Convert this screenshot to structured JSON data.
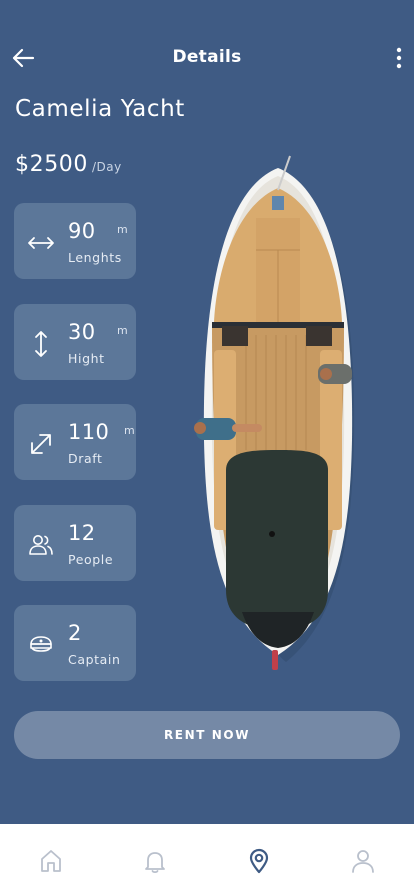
{
  "header": {
    "title": "Details",
    "back_icon": "arrow-left-icon",
    "more_icon": "more-vertical-icon"
  },
  "yacht": {
    "name": "Camelia Yacht",
    "price": "$2500",
    "price_unit": "/Day"
  },
  "stats": [
    {
      "icon": "horizontal-arrows-icon",
      "value": "90",
      "unit": "m",
      "label": "Lenghts"
    },
    {
      "icon": "vertical-arrows-icon",
      "value": "30",
      "unit": "m",
      "label": "Hight"
    },
    {
      "icon": "diagonal-arrows-icon",
      "value": "110",
      "unit": "m",
      "label": "Draft"
    },
    {
      "icon": "people-icon",
      "value": "12",
      "unit": "",
      "label": "People"
    },
    {
      "icon": "captain-hat-icon",
      "value": "2",
      "unit": "",
      "label": "Captain"
    }
  ],
  "actions": {
    "rent_label": "RENT NOW"
  },
  "bottom_nav": {
    "items": [
      "home-icon",
      "bell-icon",
      "location-pin-icon",
      "user-icon"
    ],
    "active": "location-pin-icon"
  },
  "colors": {
    "background": "#3f5b84",
    "card": "#5c7799",
    "button": "#7589a6",
    "nav_active": "#3f5b84",
    "nav_inactive": "#b9c0cc"
  }
}
